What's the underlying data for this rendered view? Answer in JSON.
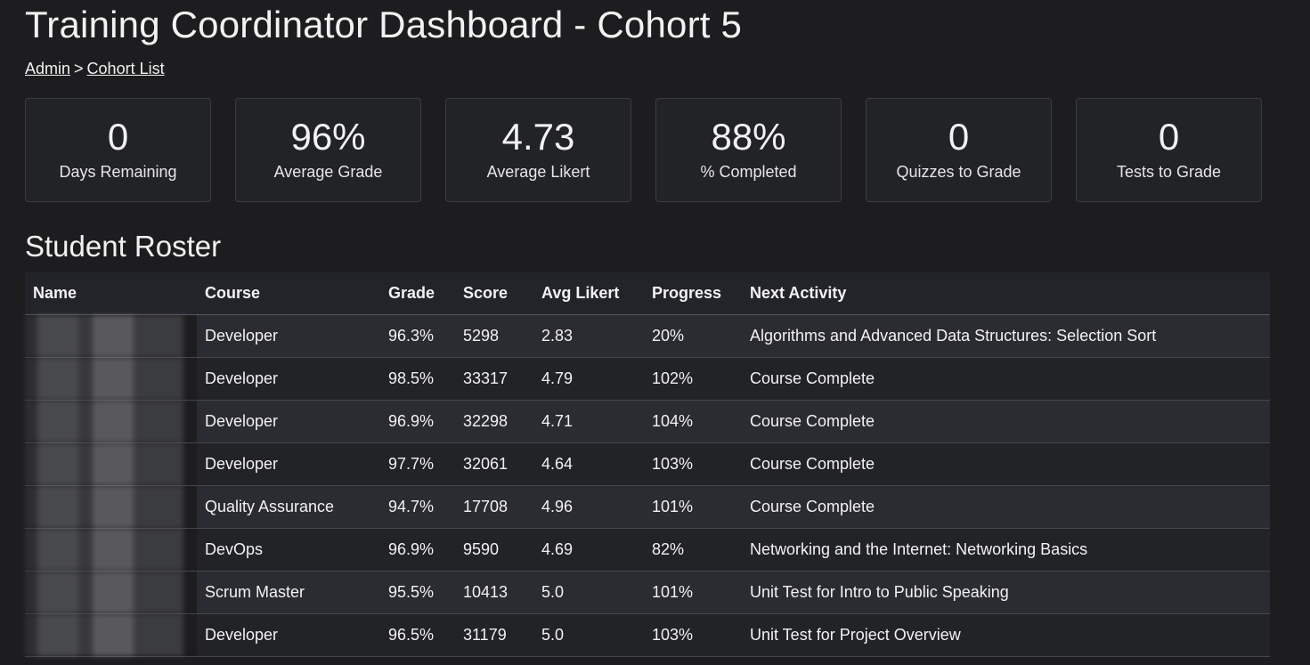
{
  "title": "Training Coordinator Dashboard - Cohort 5",
  "breadcrumb": {
    "admin": "Admin",
    "separator": ">",
    "cohort_list": "Cohort List"
  },
  "stats": [
    {
      "value": "0",
      "label": "Days Remaining"
    },
    {
      "value": "96%",
      "label": "Average Grade"
    },
    {
      "value": "4.73",
      "label": "Average Likert"
    },
    {
      "value": "88%",
      "label": "% Completed"
    },
    {
      "value": "0",
      "label": "Quizzes to Grade"
    },
    {
      "value": "0",
      "label": "Tests to Grade"
    }
  ],
  "roster": {
    "heading": "Student Roster",
    "columns": [
      "Name",
      "Course",
      "Grade",
      "Score",
      "Avg Likert",
      "Progress",
      "Next Activity"
    ],
    "rows": [
      {
        "course": "Developer",
        "grade": "96.3%",
        "score": "5298",
        "likert": "2.83",
        "progress": "20%",
        "next": "Algorithms and Advanced Data Structures: Selection Sort"
      },
      {
        "course": "Developer",
        "grade": "98.5%",
        "score": "33317",
        "likert": "4.79",
        "progress": "102%",
        "next": "Course Complete"
      },
      {
        "course": "Developer",
        "grade": "96.9%",
        "score": "32298",
        "likert": "4.71",
        "progress": "104%",
        "next": "Course Complete"
      },
      {
        "course": "Developer",
        "grade": "97.7%",
        "score": "32061",
        "likert": "4.64",
        "progress": "103%",
        "next": "Course Complete"
      },
      {
        "course": "Quality Assurance",
        "grade": "94.7%",
        "score": "17708",
        "likert": "4.96",
        "progress": "101%",
        "next": "Course Complete"
      },
      {
        "course": "DevOps",
        "grade": "96.9%",
        "score": "9590",
        "likert": "4.69",
        "progress": "82%",
        "next": "Networking and the Internet: Networking Basics"
      },
      {
        "course": "Scrum Master",
        "grade": "95.5%",
        "score": "10413",
        "likert": "5.0",
        "progress": "101%",
        "next": "Unit Test for Intro to Public Speaking"
      },
      {
        "course": "Developer",
        "grade": "96.5%",
        "score": "31179",
        "likert": "5.0",
        "progress": "103%",
        "next": "Unit Test for Project Overview"
      }
    ]
  }
}
